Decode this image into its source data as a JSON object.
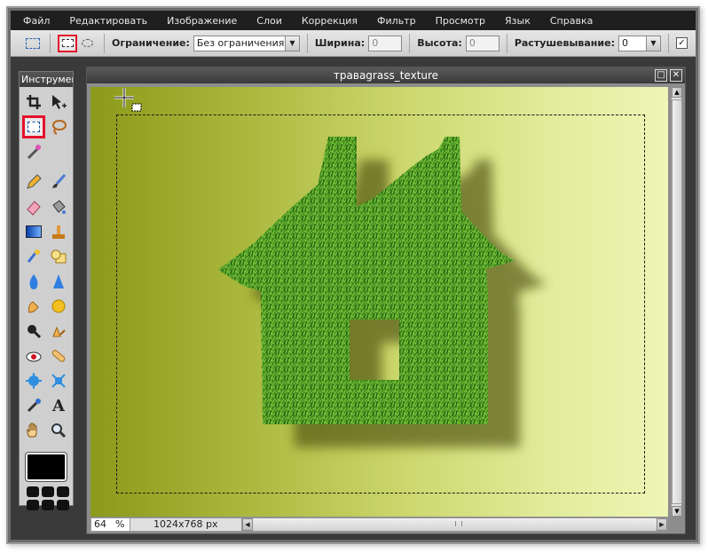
{
  "menu": [
    "Файл",
    "Редактировать",
    "Изображение",
    "Слои",
    "Коррекция",
    "Фильтр",
    "Просмотр",
    "Язык",
    "Справка"
  ],
  "options": {
    "constraint_label": "Ограничение:",
    "constraint_value": "Без ограничения",
    "width_label": "Ширина:",
    "width_value": "0",
    "height_label": "Высота:",
    "height_value": "0",
    "feather_label": "Растушевывание:",
    "feather_value": "0"
  },
  "tools_panel": {
    "title": "Инструменты"
  },
  "document": {
    "title": "травagrass_texture",
    "zoom": "64",
    "zoom_unit": "%",
    "dimensions": "1024x768 px"
  },
  "colors": {
    "accent_red": "#e4102b",
    "foreground_color": "#000000"
  }
}
